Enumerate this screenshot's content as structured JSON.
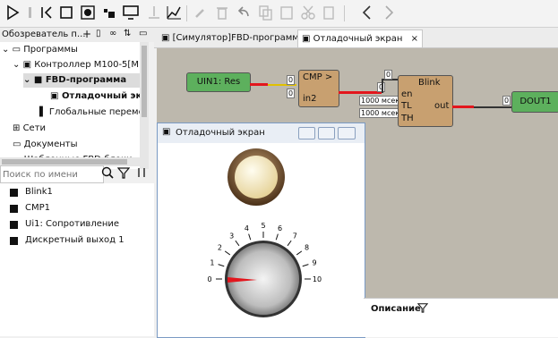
{
  "panel": {
    "title": "Обозреватель п..."
  },
  "tree": {
    "programs": "Программы",
    "controller": "Контроллер М100-5[М1...",
    "fbd": "FBD-программа",
    "debug": "Отладочный эк...",
    "globals": "Глобальные переме...",
    "networks": "Сети",
    "documents": "Документы",
    "templates": "Шаблонные FBD-блоки"
  },
  "search": {
    "placeholder": "Поиск по имени"
  },
  "list": [
    "Blink1",
    "CMP1",
    "Ui1: Сопротивление",
    "Дискретный выход 1"
  ],
  "tabs": [
    {
      "label": "[Симулятор]FBD-программа",
      "close": "×"
    },
    {
      "label": "Отладочный экран",
      "close": "×"
    }
  ],
  "diagram": {
    "uin": "UIN1: Res",
    "cmp": "CMP >",
    "cmp_in2": "in2",
    "blink": "Blink",
    "blink_en": "en",
    "blink_tl": "TL",
    "blink_th": "TH",
    "blink_out": "out",
    "dout": "DOUT1",
    "v0": "0",
    "tl": "1000 мсек",
    "th": "1000 мсек"
  },
  "debug_window": {
    "title": "Отладочный экран"
  },
  "knob": {
    "ticks": [
      "0",
      "1",
      "2",
      "3",
      "4",
      "5",
      "6",
      "7",
      "8",
      "9",
      "10"
    ],
    "value": 0
  },
  "bottom": {
    "description": "Описание"
  }
}
